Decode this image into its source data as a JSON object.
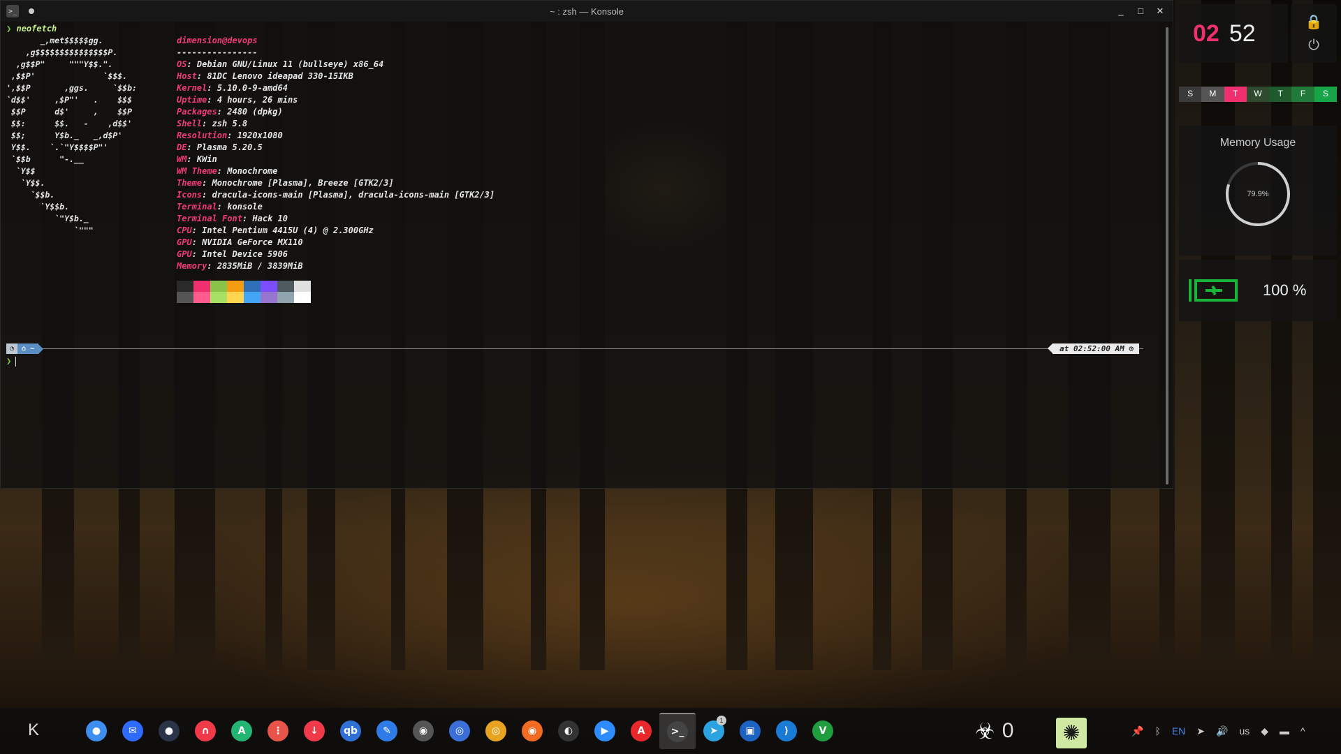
{
  "window": {
    "title": "~ : zsh — Konsole",
    "icon_text": ">_",
    "controls": [
      "_",
      "□",
      "✕"
    ]
  },
  "terminal": {
    "command": "neofetch",
    "ascii": [
      "       _,met$$$$$gg.",
      "    ,g$$$$$$$$$$$$$$$P.",
      "  ,g$$P\"     \"\"\"Y$$.\".",
      " ,$$P'              `$$$.",
      "',$$P       ,ggs.     `$$b:",
      "`d$$'     ,$P\"'   .    $$$",
      " $$P      d$'     ,    $$P",
      " $$:      $$.   -    ,d$$'",
      " $$;      Y$b._   _,d$P'",
      " Y$$.    `.`\"Y$$$$P\"'",
      " `$$b      \"-.__",
      "  `Y$$",
      "   `Y$$.",
      "     `$$b.",
      "       `Y$$b.",
      "          `\"Y$b._",
      "              `\"\"\""
    ],
    "header": "dimension@devops",
    "divider": "----------------",
    "info": [
      {
        "k": "OS",
        "v": "Debian GNU/Linux 11 (bullseye) x86_64"
      },
      {
        "k": "Host",
        "v": "81DC Lenovo ideapad 330-15IKB"
      },
      {
        "k": "Kernel",
        "v": "5.10.0-9-amd64"
      },
      {
        "k": "Uptime",
        "v": "4 hours, 26 mins"
      },
      {
        "k": "Packages",
        "v": "2480 (dpkg)"
      },
      {
        "k": "Shell",
        "v": "zsh 5.8"
      },
      {
        "k": "Resolution",
        "v": "1920x1080"
      },
      {
        "k": "DE",
        "v": "Plasma 5.20.5"
      },
      {
        "k": "WM",
        "v": "KWin"
      },
      {
        "k": "WM Theme",
        "v": "Monochrome"
      },
      {
        "k": "Theme",
        "v": "Monochrome [Plasma], Breeze [GTK2/3]"
      },
      {
        "k": "Icons",
        "v": "dracula-icons-main [Plasma], dracula-icons-main [GTK2/3]"
      },
      {
        "k": "Terminal",
        "v": "konsole"
      },
      {
        "k": "Terminal Font",
        "v": "Hack 10"
      },
      {
        "k": "CPU",
        "v": "Intel Pentium 4415U (4) @ 2.300GHz"
      },
      {
        "k": "GPU",
        "v": "NVIDIA GeForce MX110"
      },
      {
        "k": "GPU",
        "v": "Intel Device 5906"
      },
      {
        "k": "Memory",
        "v": "2835MiB / 3839MiB"
      }
    ],
    "swatches_top": [
      "#2a2a2a",
      "#f0306e",
      "#8bc34a",
      "#f39c12",
      "#2e6fb8",
      "#7c4dff",
      "#4e5a60",
      "#e0e0e0"
    ],
    "swatches_bottom": [
      "#555555",
      "#ff5c8d",
      "#a8e063",
      "#ffd54f",
      "#42a5f5",
      "#9575cd",
      "#90a4ae",
      "#ffffff"
    ],
    "prompt_left_1": "◔",
    "prompt_left_2": "⌂ ~",
    "prompt_right": "at 02:52:00 AM ⊙",
    "prompt_symbol": "❯"
  },
  "widgets": {
    "clock": {
      "hours": "02",
      "minutes": "52"
    },
    "lock_icon": "🔒",
    "power_icon": "⏻",
    "week": [
      {
        "d": "S",
        "bg": "#3a3a3a"
      },
      {
        "d": "M",
        "bg": "#555555"
      },
      {
        "d": "T",
        "bg": "#f0306e"
      },
      {
        "d": "W",
        "bg": "#2f4a2f"
      },
      {
        "d": "T",
        "bg": "#1f5a2f"
      },
      {
        "d": "F",
        "bg": "#207a3a"
      },
      {
        "d": "S",
        "bg": "#18a548"
      }
    ],
    "memory": {
      "title": "Memory Usage",
      "percent_label": "79.9%",
      "fraction": 0.799
    },
    "battery": {
      "percent_label": "100 %",
      "icon_color": "#18b53a"
    }
  },
  "taskbar": {
    "start_icon": "K",
    "apps": [
      {
        "name": "toggle-app",
        "glyph": "●",
        "bg": "#3d8ef0"
      },
      {
        "name": "mail-app",
        "glyph": "✉",
        "bg": "#2f6bff"
      },
      {
        "name": "dark-app",
        "glyph": "●",
        "bg": "#2b3348"
      },
      {
        "name": "headphones-app",
        "glyph": "∩",
        "bg": "#f03a4a"
      },
      {
        "name": "arch-app",
        "glyph": "A",
        "bg": "#22b573"
      },
      {
        "name": "mixer-app",
        "glyph": "⋮",
        "bg": "#e8534a"
      },
      {
        "name": "download-app",
        "glyph": "↓",
        "bg": "#f03a4a"
      },
      {
        "name": "qbittorrent-app",
        "glyph": "qb",
        "bg": "#2f6fd6"
      },
      {
        "name": "feather-app",
        "glyph": "✎",
        "bg": "#2f7be8"
      },
      {
        "name": "github-app",
        "glyph": "◉",
        "bg": "#555555"
      },
      {
        "name": "chromium-app",
        "glyph": "◎",
        "bg": "#3a6fd8"
      },
      {
        "name": "chrome-app",
        "glyph": "◎",
        "bg": "#e8a321"
      },
      {
        "name": "firefox-app",
        "glyph": "◉",
        "bg": "#f26b22"
      },
      {
        "name": "obs-app",
        "glyph": "◐",
        "bg": "#333333"
      },
      {
        "name": "zoom-app",
        "glyph": "▶",
        "bg": "#2d8cff"
      },
      {
        "name": "acrobat-app",
        "glyph": "A",
        "bg": "#e8282b"
      },
      {
        "name": "konsole-app",
        "glyph": ">_",
        "bg": "#444444",
        "active": true
      },
      {
        "name": "telegram-app",
        "glyph": "➤",
        "bg": "#2aa3e0",
        "badge": "1"
      },
      {
        "name": "virtualbox-app",
        "glyph": "▣",
        "bg": "#1d63c2"
      },
      {
        "name": "vscode-app",
        "glyph": "⟩",
        "bg": "#1a7bd6"
      },
      {
        "name": "vim-app",
        "glyph": "V",
        "bg": "#1f9d3f"
      }
    ],
    "counter_icon": "☣",
    "counter_value": "0",
    "fan_icon": "✺",
    "tray": {
      "pin": "📌",
      "bluetooth": "ᛒ",
      "lang": "EN",
      "send": "➤",
      "volume": "🔊",
      "layout": "us",
      "wifi": "◆",
      "display": "▬",
      "arrow": "^"
    }
  }
}
